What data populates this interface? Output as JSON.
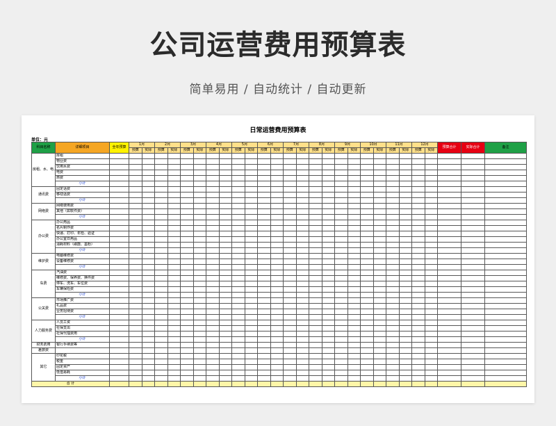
{
  "hero": {
    "title": "公司运营费用预算表",
    "subtitle": "简单易用  /  自动统计  /  自动更新"
  },
  "sheet": {
    "title": "日常运营费用预算表",
    "unit": "单位：元",
    "headers": {
      "category": "科目名称",
      "detail": "详细项目",
      "annual": "全年预算",
      "budget_total": "预算合计",
      "actual_total": "实际合计",
      "remark": "备注",
      "budget": "预算",
      "actual": "实际"
    },
    "months": [
      "1月",
      "2月",
      "3月",
      "4月",
      "5月",
      "6月",
      "7月",
      "8月",
      "9月",
      "10月",
      "11月",
      "12月"
    ],
    "colors": {
      "green": "#1fa046",
      "orange": "#f5a623",
      "yellow": "#fff200",
      "red": "#e60012"
    },
    "subtotal_label": "小计",
    "total_label": "合  计",
    "groups": [
      {
        "name": "房租、水、电、燃、气费",
        "items": [
          "房租",
          "物业费",
          "饮用水费",
          "电费",
          "燃费"
        ],
        "subtotal": true
      },
      {
        "name": "通讯费",
        "items": [
          "固定话费",
          "移动话费"
        ],
        "subtotal": true
      },
      {
        "name": "网络费",
        "items": [
          "网络使用费",
          "其他（如软件费）"
        ],
        "subtotal": true
      },
      {
        "name": "办公费",
        "items": [
          "办公用品",
          "名片制作费",
          "快递、打印、年检、验证",
          "办公室日用品",
          "消耗材料（硒鼓、墨粉）"
        ],
        "subtotal": true
      },
      {
        "name": "维护费",
        "items": [
          "电脑维修费",
          "设备维修费"
        ],
        "subtotal": true
      },
      {
        "name": "车费",
        "items": [
          "汽油费",
          "维修费、保养费、换件费",
          "停车、洗车、车位费",
          "车辆保险费"
        ],
        "subtotal": true
      },
      {
        "name": "公关费",
        "items": [
          "市场推广费",
          "礼品费",
          "业务招待费"
        ],
        "subtotal": true
      },
      {
        "name": "人力服务费",
        "items": [
          "人员工资",
          "社保支出",
          "社保代理费用"
        ],
        "subtotal": true
      },
      {
        "name": "财务费用",
        "items": [
          "银行手续费等"
        ],
        "subtotal": false
      },
      {
        "name": "差旅费",
        "items": [
          ""
        ],
        "subtotal": false
      },
      {
        "name": "其它",
        "items": [
          "印花税",
          "税金",
          "固定资产",
          "低值易耗"
        ],
        "subtotal": true
      }
    ]
  }
}
